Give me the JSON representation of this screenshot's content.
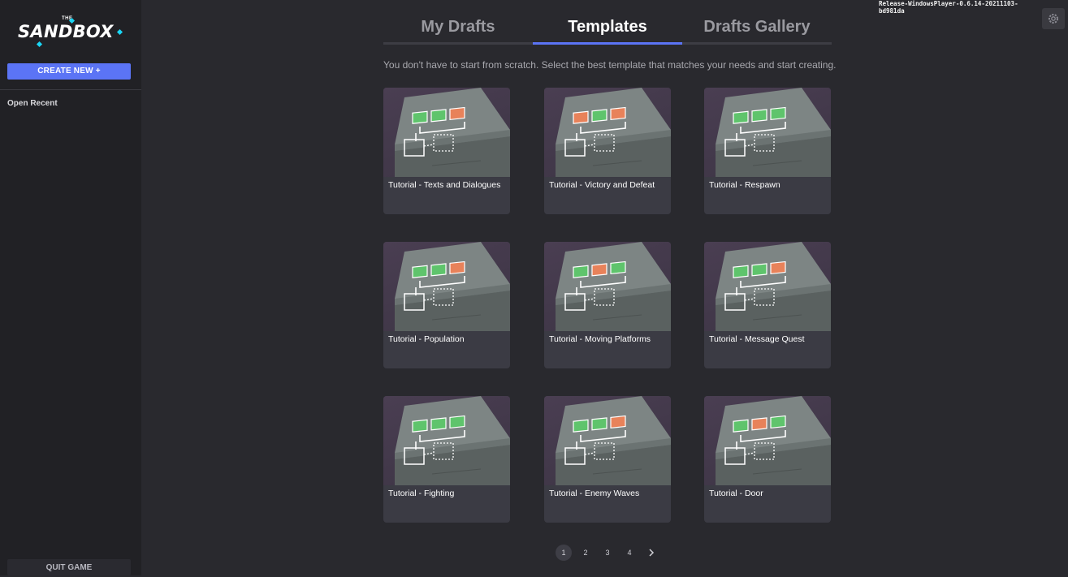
{
  "sidebar": {
    "logo_the": "THE",
    "logo_word": "SANDBOX",
    "create_new": "CREATE NEW +",
    "open_recent": "Open Recent",
    "quit_game": "QUIT GAME"
  },
  "tabs": [
    {
      "label": "My Drafts",
      "active": false
    },
    {
      "label": "Templates",
      "active": true
    },
    {
      "label": "Drafts Gallery",
      "active": false
    }
  ],
  "subtitle": "You don't have to start from scratch. Select the best template that matches your needs and start creating.",
  "templates": [
    {
      "title": "Tutorial - Texts and Dialogues"
    },
    {
      "title": "Tutorial - Victory and Defeat"
    },
    {
      "title": "Tutorial - Respawn"
    },
    {
      "title": "Tutorial - Population"
    },
    {
      "title": "Tutorial - Moving Platforms"
    },
    {
      "title": "Tutorial - Message Quest"
    },
    {
      "title": "Tutorial - Fighting"
    },
    {
      "title": "Tutorial - Enemy Waves"
    },
    {
      "title": "Tutorial - Door"
    }
  ],
  "pagination": {
    "pages": [
      "1",
      "2",
      "3",
      "4"
    ],
    "current": "1",
    "next_icon": "chevron-right-icon"
  },
  "build_label": "Release-WindowsPlayer-0.6.14-20211103-bd981da",
  "settings_icon": "gear-icon",
  "colors": {
    "accent": "#5b74f5",
    "background": "#29292e",
    "sidebar": "#212125",
    "node_green": "#5fc46c",
    "node_orange": "#e8825a",
    "node_blue": "#4a90e2"
  }
}
